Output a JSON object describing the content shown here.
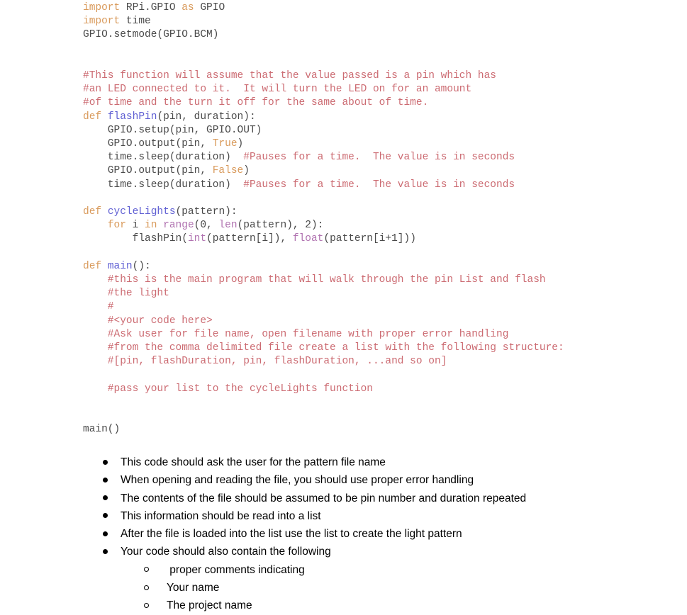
{
  "document": {
    "background": "#ffffff",
    "palette": {
      "plain": "#4a4a4a",
      "keyword": "#d99a5b",
      "comment": "#cc6b72",
      "function_name": "#5f5fd3",
      "builtin": "#b072b0",
      "bullet": "#000000",
      "body_text": "#000000"
    }
  },
  "code": {
    "language": "python",
    "lines": [
      [
        {
          "t": "import",
          "c": "keyword"
        },
        {
          "t": " RPi.GPIO ",
          "c": "plain"
        },
        {
          "t": "as",
          "c": "keyword"
        },
        {
          "t": " GPIO",
          "c": "plain"
        }
      ],
      [
        {
          "t": "import",
          "c": "keyword"
        },
        {
          "t": " time",
          "c": "plain"
        }
      ],
      [
        {
          "t": "GPIO.setmode(GPIO.BCM)",
          "c": "plain"
        }
      ],
      [],
      [],
      [
        {
          "t": "#This function will assume that the value passed is a pin which has",
          "c": "comment"
        }
      ],
      [
        {
          "t": "#an LED connected to it.  It will turn the LED on for an amount",
          "c": "comment"
        }
      ],
      [
        {
          "t": "#of time and the turn it off for the same about of time.",
          "c": "comment"
        }
      ],
      [
        {
          "t": "def",
          "c": "keyword"
        },
        {
          "t": " ",
          "c": "plain"
        },
        {
          "t": "flashPin",
          "c": "function_name"
        },
        {
          "t": "(pin, duration):",
          "c": "plain"
        }
      ],
      [
        {
          "t": "    GPIO.setup(pin, GPIO.OUT)",
          "c": "plain"
        }
      ],
      [
        {
          "t": "    GPIO.output(pin, ",
          "c": "plain"
        },
        {
          "t": "True",
          "c": "keyword"
        },
        {
          "t": ")",
          "c": "plain"
        }
      ],
      [
        {
          "t": "    time.sleep(duration) ",
          "c": "plain"
        },
        {
          "t": " #Pauses for a time.  The value is in seconds",
          "c": "comment"
        }
      ],
      [
        {
          "t": "    GPIO.output(pin, ",
          "c": "plain"
        },
        {
          "t": "False",
          "c": "keyword"
        },
        {
          "t": ")",
          "c": "plain"
        }
      ],
      [
        {
          "t": "    time.sleep(duration) ",
          "c": "plain"
        },
        {
          "t": " #Pauses for a time.  The value is in seconds",
          "c": "comment"
        }
      ],
      [],
      [
        {
          "t": "def",
          "c": "keyword"
        },
        {
          "t": " ",
          "c": "plain"
        },
        {
          "t": "cycleLights",
          "c": "function_name"
        },
        {
          "t": "(pattern):",
          "c": "plain"
        }
      ],
      [
        {
          "t": "    ",
          "c": "plain"
        },
        {
          "t": "for",
          "c": "keyword"
        },
        {
          "t": " i ",
          "c": "plain"
        },
        {
          "t": "in",
          "c": "keyword"
        },
        {
          "t": " ",
          "c": "plain"
        },
        {
          "t": "range",
          "c": "builtin"
        },
        {
          "t": "(0, ",
          "c": "plain"
        },
        {
          "t": "len",
          "c": "builtin"
        },
        {
          "t": "(pattern), 2):",
          "c": "plain"
        }
      ],
      [
        {
          "t": "        flashPin(",
          "c": "plain"
        },
        {
          "t": "int",
          "c": "builtin"
        },
        {
          "t": "(pattern[i]), ",
          "c": "plain"
        },
        {
          "t": "float",
          "c": "builtin"
        },
        {
          "t": "(pattern[i+1]))",
          "c": "plain"
        }
      ],
      [],
      [
        {
          "t": "def",
          "c": "keyword"
        },
        {
          "t": " ",
          "c": "plain"
        },
        {
          "t": "main",
          "c": "function_name"
        },
        {
          "t": "():",
          "c": "plain"
        }
      ],
      [
        {
          "t": "    #this is the main program that will walk through the pin List and flash",
          "c": "comment"
        }
      ],
      [
        {
          "t": "    #the light",
          "c": "comment"
        }
      ],
      [
        {
          "t": "    #",
          "c": "comment"
        }
      ],
      [
        {
          "t": "    #<your code here>",
          "c": "comment"
        }
      ],
      [
        {
          "t": "    #Ask user for file name, open filename with proper error handling",
          "c": "comment"
        }
      ],
      [
        {
          "t": "    #from the comma delimited file create a list with the following structure:",
          "c": "comment"
        }
      ],
      [
        {
          "t": "    #[pin, flashDuration, pin, flashDuration, ...and so on]",
          "c": "comment"
        }
      ],
      [],
      [
        {
          "t": "    #pass your list to the cycleLights function",
          "c": "comment"
        }
      ],
      [],
      [],
      [
        {
          "t": "main()",
          "c": "plain"
        }
      ]
    ]
  },
  "requirements": {
    "items": [
      {
        "level": 1,
        "marker": "disc",
        "text": "This code should ask the user for the pattern file name"
      },
      {
        "level": 1,
        "marker": "disc",
        "text": "When opening and reading the file, you should use proper error handling"
      },
      {
        "level": 1,
        "marker": "disc",
        "text": "The contents of the file should be assumed to be pin number and duration repeated"
      },
      {
        "level": 1,
        "marker": "disc",
        "text": "This information should be read into a list"
      },
      {
        "level": 1,
        "marker": "disc",
        "text": "After the file is loaded into the list use the list to create the light pattern"
      },
      {
        "level": 1,
        "marker": "disc",
        "text": "Your code should also contain the following"
      },
      {
        "level": 2,
        "marker": "circle",
        "text": " proper comments indicating"
      },
      {
        "level": 2,
        "marker": "circle",
        "text": "Your name"
      },
      {
        "level": 2,
        "marker": "circle",
        "text": "The project name"
      }
    ]
  }
}
